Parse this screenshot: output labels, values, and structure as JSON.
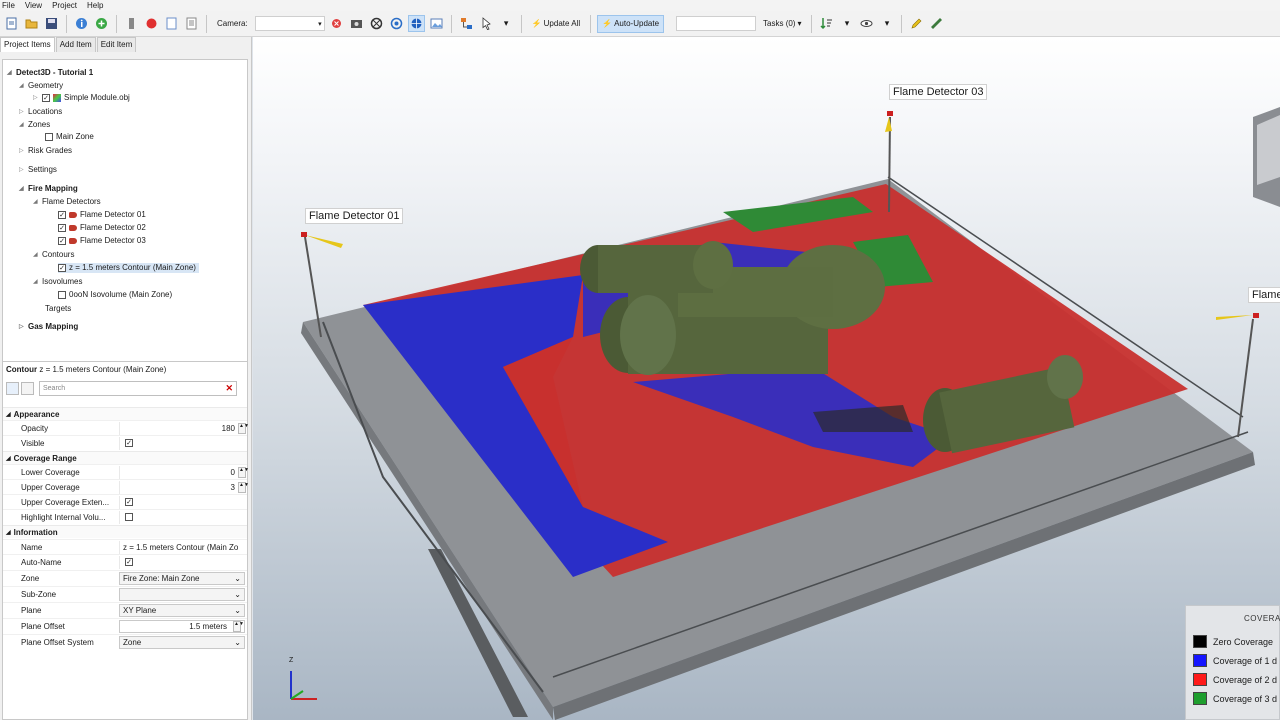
{
  "menu": [
    "File",
    "View",
    "Project",
    "Help"
  ],
  "toolbar": {
    "camera_label": "Camera:",
    "camera_value": "",
    "update_all": "Update All",
    "auto_update": "Auto-Update",
    "tasks": "Tasks (0)"
  },
  "tabs": [
    "Project Items",
    "Add Item",
    "Edit Item"
  ],
  "tree": {
    "root": "Detect3D - Tutorial 1",
    "geometry": "Geometry",
    "simple_module": "Simple Module.obj",
    "locations": "Locations",
    "zones": "Zones",
    "main_zone": "Main Zone",
    "risk_grades": "Risk Grades",
    "settings": "Settings",
    "fire_mapping": "Fire Mapping",
    "flame_detectors": "Flame Detectors",
    "fd1": "Flame Detector 01",
    "fd2": "Flame Detector 02",
    "fd3": "Flame Detector 03",
    "contours": "Contours",
    "contour_item": "z = 1.5 meters Contour (Main Zone)",
    "isovolumes": "Isovolumes",
    "isovolume_item": "0ooN Isovolume (Main Zone)",
    "targets": "Targets",
    "gas_mapping": "Gas Mapping"
  },
  "props": {
    "title_type": "Contour",
    "title_name": "z = 1.5 meters Contour (Main Zone)",
    "search_placeholder": "Search",
    "appearance": "Appearance",
    "opacity_label": "Opacity",
    "opacity_value": "180",
    "visible_label": "Visible",
    "coverage_range": "Coverage Range",
    "lower_label": "Lower Coverage",
    "lower_value": "0",
    "upper_label": "Upper Coverage",
    "upper_value": "3",
    "upper_ext_label": "Upper Coverage Exten...",
    "highlight_label": "Highlight Internal Volu...",
    "information": "Information",
    "name_label": "Name",
    "name_value": "z = 1.5 meters Contour (Main Zo",
    "autoname_label": "Auto-Name",
    "zone_label": "Zone",
    "zone_value": "Fire Zone: Main Zone",
    "subzone_label": "Sub-Zone",
    "subzone_value": "",
    "plane_label": "Plane",
    "plane_value": "XY Plane",
    "offset_label": "Plane Offset",
    "offset_value": "1.5 meters",
    "offset_sys_label": "Plane Offset System",
    "offset_sys_value": "Zone"
  },
  "viewport": {
    "detector1": "Flame Detector 01",
    "detector3": "Flame Detector 03",
    "detector2_partial": "Flame",
    "legend_title": "COVERAG",
    "legend": [
      {
        "label": "Zero Coverage",
        "color": "#000000"
      },
      {
        "label": "Coverage of 1 d",
        "color": "#1515ff"
      },
      {
        "label": "Coverage of 2 d",
        "color": "#ff1a1a"
      },
      {
        "label": "Coverage of 3 d",
        "color": "#1e9e2e"
      }
    ],
    "axis_z": "Z"
  }
}
